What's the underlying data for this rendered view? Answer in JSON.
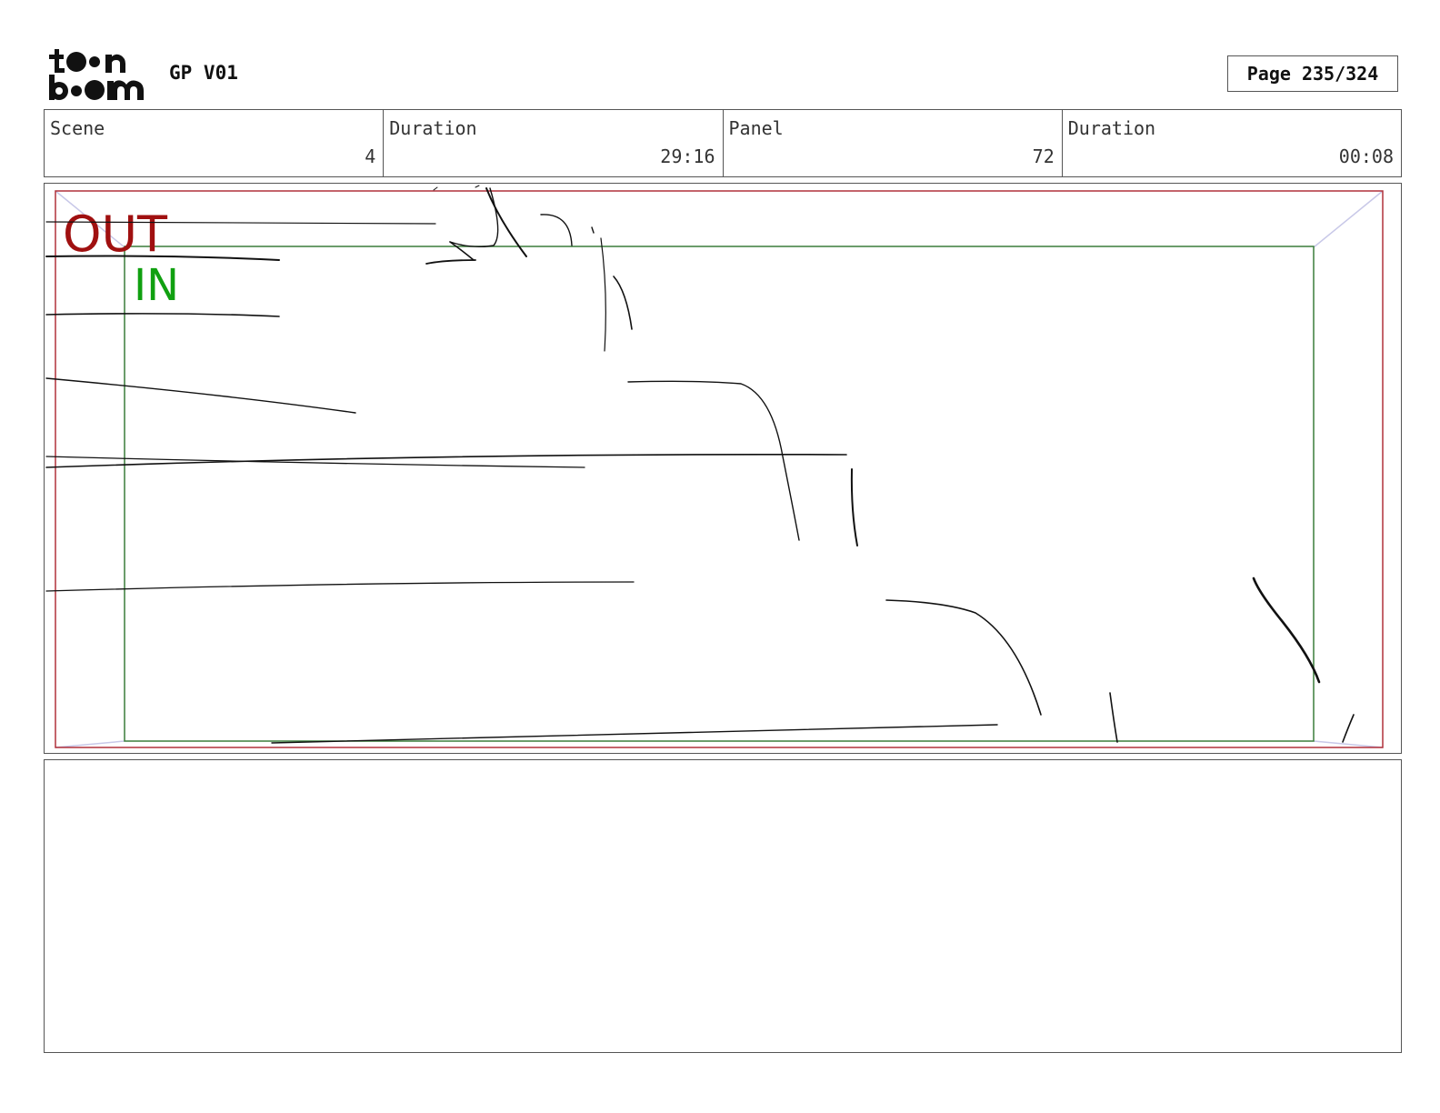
{
  "header": {
    "logo_text": "toonboom",
    "project_title": "GP V01",
    "page_label": "Page 235/324"
  },
  "info_bar": {
    "scene_label": "Scene",
    "scene_value": "4",
    "scene_duration_label": "Duration",
    "scene_duration_value": "29:16",
    "panel_label": "Panel",
    "panel_value": "72",
    "panel_duration_label": "Duration",
    "panel_duration_value": "00:08"
  },
  "panel": {
    "out_label": "OUT",
    "in_label": "IN",
    "colors": {
      "out_frame": "#b0303a",
      "in_frame": "#3a7d3a",
      "out_text": "#a01010",
      "in_text": "#10a010",
      "sketch": "#111111",
      "corner_lines": "#c8c8e8"
    }
  },
  "notes": {
    "text": ""
  }
}
